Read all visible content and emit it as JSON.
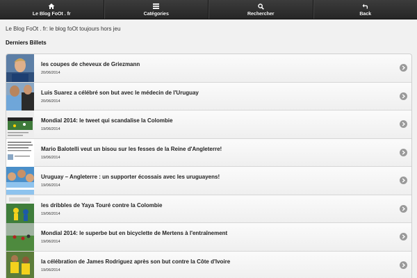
{
  "navbar": {
    "items": [
      {
        "label": "Le Blog FoOt . fr",
        "icon": "home-icon"
      },
      {
        "label": "Catégories",
        "icon": "menu-icon"
      },
      {
        "label": "Rechercher",
        "icon": "search-icon"
      },
      {
        "label": "Back",
        "icon": "back-icon"
      }
    ]
  },
  "site_description": "Le Blog FoOt . fr: le blog foOt toujours hors jeu",
  "section_title": "Derniers Billets",
  "posts": [
    {
      "title": "les coupes de cheveux de Griezmann",
      "date": "20/06/2014",
      "thumb": "photo-player-portrait"
    },
    {
      "title": "Luis Suarez a célébré son but avec le médecin de l'Uruguay",
      "date": "20/06/2014",
      "thumb": "photo-celebration"
    },
    {
      "title": "Mondial 2014: le tweet qui scandalise la Colombie",
      "date": "19/06/2014",
      "thumb": "photo-pitch"
    },
    {
      "title": "Mario Balotelli veut un bisou sur les fesses de la Reine d'Angleterre!",
      "date": "19/06/2014",
      "thumb": "tweet-screenshot"
    },
    {
      "title": "Uruguay – Angleterre : un supporter écossais avec les uruguayens!",
      "date": "19/06/2014",
      "thumb": "photo-supporters"
    },
    {
      "title": "les dribbles de Yaya Touré contre la Colombie",
      "date": "19/06/2014",
      "thumb": "photo-match-adidas"
    },
    {
      "title": "Mondial 2014: le superbe but en bicyclette de Mertens à l'entraînement",
      "date": "19/06/2014",
      "thumb": "photo-training"
    },
    {
      "title": "la célébration de James Rodriguez après son but contre la Côte d'Ivoire",
      "date": "19/06/2014",
      "thumb": "photo-players-yellow"
    }
  ],
  "colors": {
    "navbar": "#2b2b2b",
    "background": "#f1f1f1",
    "arrow": "#9a9a9a"
  }
}
